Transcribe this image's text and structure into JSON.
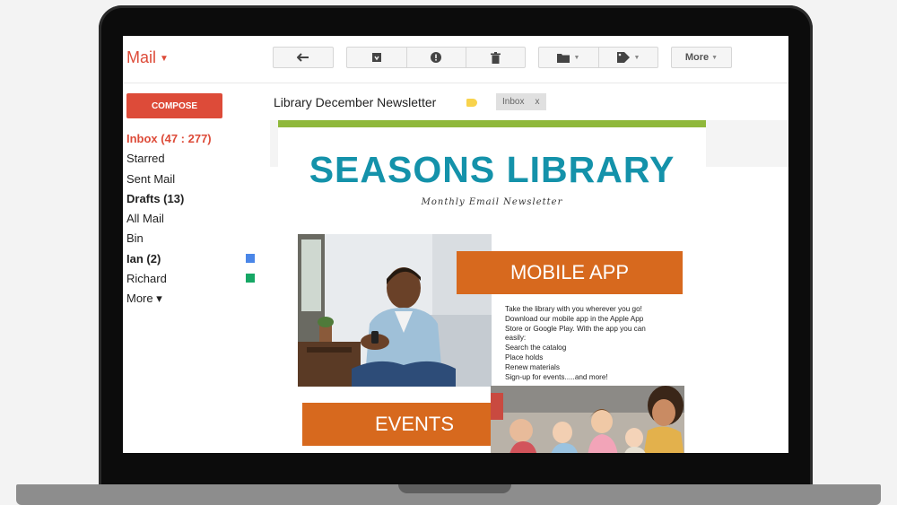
{
  "mail": {
    "logo": "Mail",
    "toolbar": {
      "more": "More"
    },
    "compose": "COMPOSE",
    "nav": [
      {
        "label": "Inbox (47 : 277)",
        "style": "inbox"
      },
      {
        "label": "Starred",
        "style": ""
      },
      {
        "label": "Sent Mail",
        "style": ""
      },
      {
        "label": "Drafts (13)",
        "style": "bold"
      },
      {
        "label": "All Mail",
        "style": ""
      },
      {
        "label": "Bin",
        "style": ""
      },
      {
        "label": "Ian (2)",
        "style": "bold",
        "color": "#4a86e8"
      },
      {
        "label": "Richard",
        "style": "",
        "color": "#16a765"
      },
      {
        "label": "More ▾",
        "style": ""
      }
    ],
    "subject": "Library December Newsletter",
    "label_chip": "Inbox",
    "label_chip_close": "x"
  },
  "newsletter": {
    "title": "SEASONS LIBRARY",
    "subtitle": "Monthly Email Newsletter",
    "mobile_heading": "MOBILE APP",
    "mobile_lines": [
      "Take the library with you wherever you go!",
      "Download our mobile app in the Apple App",
      "Store or Google Play. With the app you can",
      "easily:",
      "Search the catalog",
      "Place holds",
      "Renew materials",
      "Sign-up for events.....and more!"
    ],
    "events_heading": "EVENTS"
  },
  "colors": {
    "gmail_red": "#dd4b39",
    "title_teal": "#1492aa",
    "banner_orange": "#d7691e",
    "accent_green": "#8fb83b"
  }
}
